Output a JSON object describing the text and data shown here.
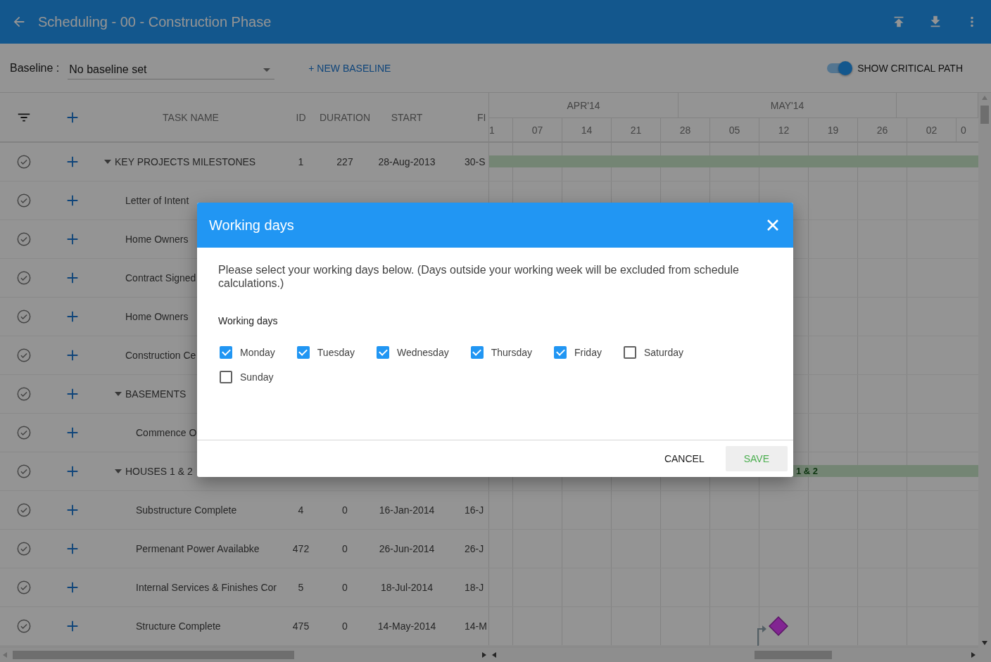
{
  "app_bar": {
    "title": "Scheduling - 00 - Construction Phase"
  },
  "toolbar": {
    "baseline_label": "Baseline :",
    "baseline_value": "No baseline set",
    "new_baseline": "+ NEW BASELINE",
    "critical_path": {
      "label": "SHOW CRITICAL PATH",
      "on": true
    }
  },
  "table": {
    "columns": [
      "TASK NAME",
      "ID",
      "DURATION",
      "START",
      "FI"
    ],
    "rows": [
      {
        "name": "KEY PROJECTS MILESTONES",
        "id": "1",
        "duration": "227",
        "start": "28-Aug-2013",
        "finish": "30-S",
        "expanded": true,
        "bar": {
          "kind": "summary"
        },
        "children": [
          {
            "name": "Letter of Intent"
          },
          {
            "name": "Home Owners"
          },
          {
            "name": "Contract Signed"
          },
          {
            "name": "Home Owners"
          },
          {
            "name": "Construction Ce"
          },
          {
            "name": "BASEMENTS",
            "expanded": true,
            "children": [
              {
                "name": "Commence O"
              }
            ]
          },
          {
            "name": "HOUSES 1 & 2",
            "expanded": true,
            "bar": {
              "kind": "summary",
              "label": "1 & 2"
            },
            "children": [
              {
                "name": "Substructure Complete",
                "id": "4",
                "duration": "0",
                "start": "16-Jan-2014",
                "finish": "16-J"
              },
              {
                "name": "Permenant Power Availabke",
                "id": "472",
                "duration": "0",
                "start": "26-Jun-2014",
                "finish": "26-J"
              },
              {
                "name": "Internal Services & Finishes Cor",
                "id": "5",
                "duration": "0",
                "start": "18-Jul-2014",
                "finish": "18-J"
              },
              {
                "name": "Structure Complete",
                "id": "475",
                "duration": "0",
                "start": "14-May-2014",
                "finish": "14-M",
                "bar": {
                  "kind": "milestone"
                }
              }
            ]
          }
        ]
      }
    ]
  },
  "timeline": {
    "months": [
      "APR'14",
      "MAY'14"
    ],
    "weeks": [
      "1",
      "07",
      "14",
      "21",
      "28",
      "05",
      "12",
      "19",
      "26",
      "02",
      "0"
    ]
  },
  "dialog": {
    "title": "Working days",
    "message": "Please select your working days below. (Days outside your working week will be excluded from schedule calculations.)",
    "group_label": "Working days",
    "days": [
      {
        "label": "Monday",
        "checked": true
      },
      {
        "label": "Tuesday",
        "checked": true
      },
      {
        "label": "Wednesday",
        "checked": true
      },
      {
        "label": "Thursday",
        "checked": true
      },
      {
        "label": "Friday",
        "checked": true
      },
      {
        "label": "Saturday",
        "checked": false
      },
      {
        "label": "Sunday",
        "checked": false
      }
    ],
    "buttons": [
      {
        "label": "CANCEL",
        "kind": "text"
      },
      {
        "label": "SAVE",
        "kind": "primary"
      }
    ]
  }
}
